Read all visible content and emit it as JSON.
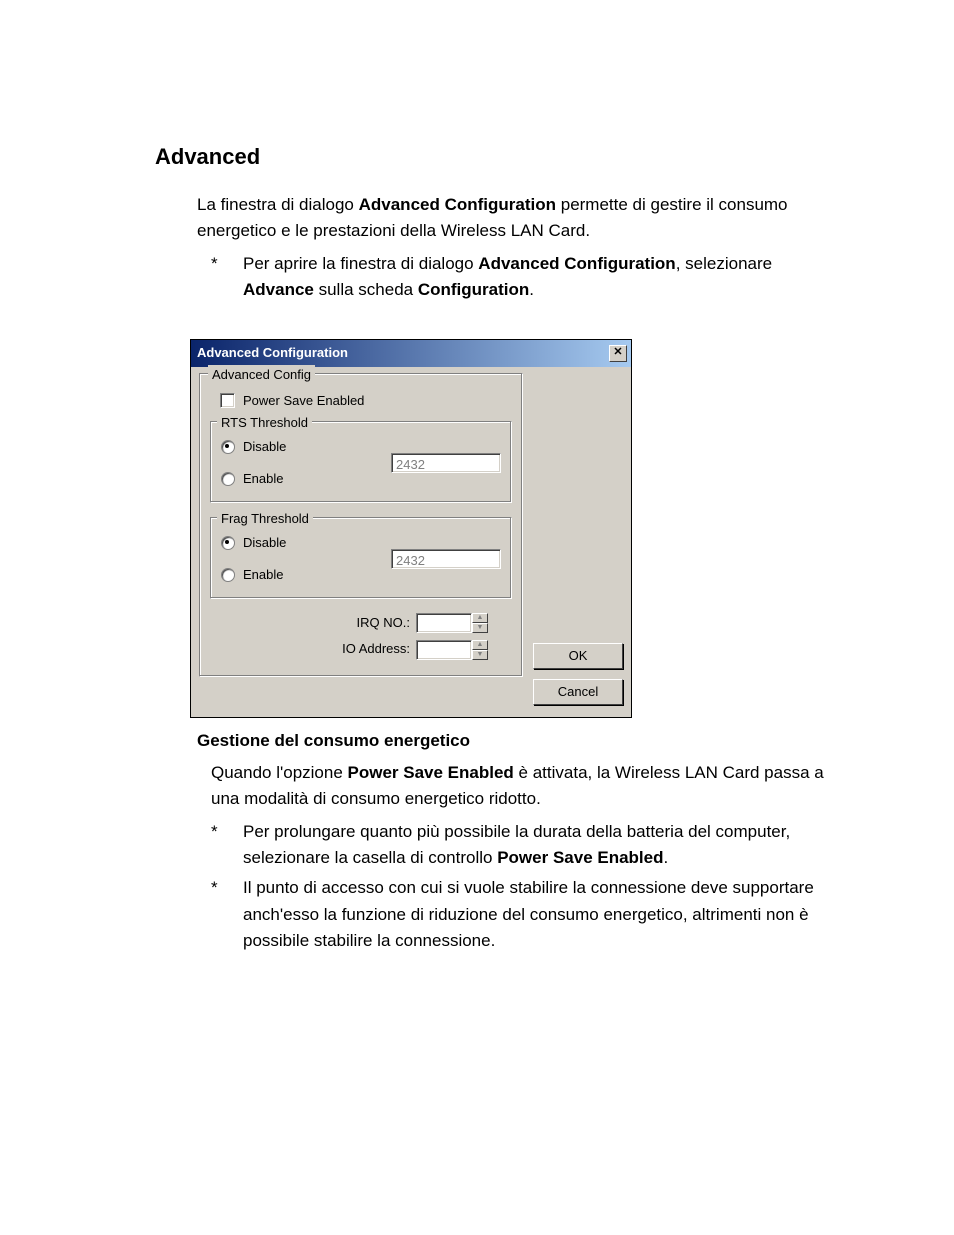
{
  "doc": {
    "heading": "Advanced",
    "intro_parts": [
      "La finestra di dialogo ",
      "Advanced Configuration",
      " permette di gestire il consumo energetico e le prestazioni della Wireless LAN Card."
    ],
    "bullet1_parts": [
      "Per aprire la finestra di dialogo ",
      "Advanced Configuration",
      ", selezionare ",
      "Advance",
      " sulla scheda ",
      "Configuration",
      "."
    ],
    "power_heading": "Gestione del consumo energetico",
    "power_para_parts": [
      "Quando l'opzione ",
      "Power Save Enabled",
      " è attivata, la Wireless LAN Card passa a una modalità di consumo energetico ridotto."
    ],
    "bullet2_parts": [
      "Per prolungare quanto più possibile la durata della batteria del computer, selezionare la casella di controllo ",
      "Power Save Enabled",
      "."
    ],
    "bullet3": "Il punto di accesso con cui si vuole stabilire la connessione deve supportare anch'esso la funzione di riduzione del consumo energetico, altrimenti non è possibile stabilire la connessione.",
    "star": "*"
  },
  "dialog": {
    "title": "Advanced Configuration",
    "close_glyph": "✕",
    "advanced_config_legend": "Advanced Config",
    "power_save_label": "Power Save Enabled",
    "rts": {
      "legend": "RTS Threshold",
      "disable": "Disable",
      "enable": "Enable",
      "value": "2432"
    },
    "frag": {
      "legend": "Frag Threshold",
      "disable": "Disable",
      "enable": "Enable",
      "value": "2432"
    },
    "irq_label": "IRQ NO.:",
    "io_label": "IO Address:",
    "ok": "OK",
    "cancel": "Cancel"
  }
}
